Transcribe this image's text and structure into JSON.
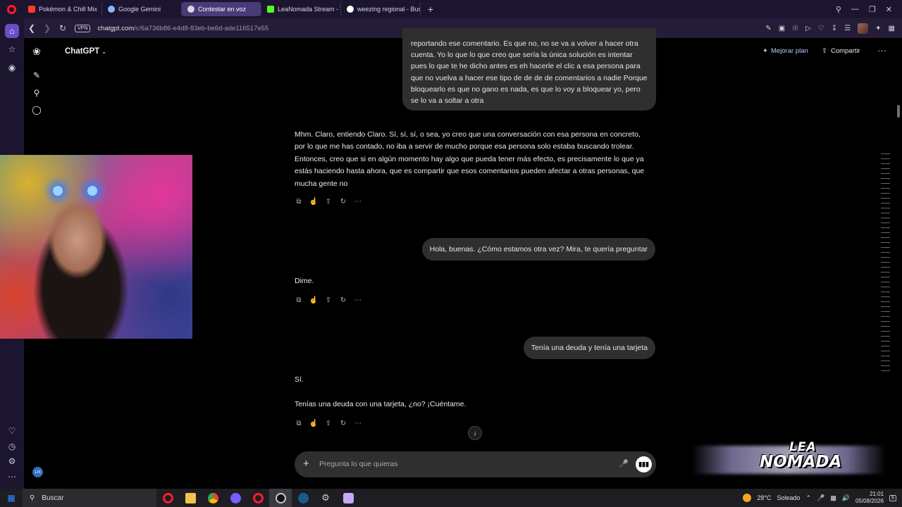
{
  "browser": {
    "tabs": [
      {
        "label": "Pokémon & Chill Mix",
        "color": "#ff3b30"
      },
      {
        "label": "Google Gemini",
        "color": "#8ab4ff"
      },
      {
        "label": "Contestar en voz",
        "color": "#d9d9d9",
        "active": true
      },
      {
        "label": "LeaNomada Stream - Wat",
        "color": "#53fc18"
      },
      {
        "label": "weezing regional - Buscar",
        "color": "#ffffff"
      }
    ],
    "new_tab": "+",
    "vpn_badge": "VPN",
    "url_host": "chatgpt.com",
    "url_path": "/c/6a736b86-e4d8-83eb-be6d-ade116517e55"
  },
  "app": {
    "model_name": "ChatGPT",
    "upgrade_label": "Mejorar plan",
    "share_label": "Compartir",
    "more_label": "···"
  },
  "rail": {
    "avatar_initials": "LN"
  },
  "chat": {
    "user_top": "reportando ese comentario. Es que no, no se va a volver a hacer otra cuenta. Yo lo que lo que creo que sería la única solución es intentar pues lo que te he dicho antes es eh hacerle el clic a esa persona para que no vuelva a hacer ese tipo de de de de comentarios a nadie Porque bloquearlo es que no gano es nada, es que lo voy a bloquear yo, pero se lo va a soltar a otra",
    "assistant_1": "Mhm. Claro, entiendo Claro. Sí, sí, sí, o sea, yo creo que una conversación con esa persona en concreto, por lo que me has contado, no iba a servir de mucho porque esa persona solo estaba buscando trolear. Entonces, creo que si en algún momento hay algo que pueda tener más efecto, es precisamente lo que ya estás haciendo hasta ahora, que es compartir que esos comentarios pueden afectar a otras personas, que mucha gente no",
    "user_2": "Hola, buenas. ¿Cómo estamos otra vez? Mira, te quería preguntar",
    "assistant_2": "Dime.",
    "user_3": "Tenía una deuda y tenía una tarjeta",
    "assistant_3a": "Sí.",
    "assistant_3b": "Tenías una deuda con una tarjeta, ¿no? ¡Cuéntame."
  },
  "composer": {
    "placeholder": "Pregunta lo que quieras"
  },
  "overlay": {
    "logo_line1": "LEA",
    "logo_line2": "NOMADA"
  },
  "taskbar": {
    "search_label": "Buscar",
    "weather_temp": "28°C",
    "weather_text": "Soleado",
    "time": "21:01",
    "date": "05/08/2026",
    "notif_count": "6"
  },
  "colors": {
    "accent_purple": "#6b4ec7",
    "upgrade_blue": "#b9c8ff",
    "bubble_bg": "#2f2f2f",
    "opera_red": "#ff1b2d"
  }
}
